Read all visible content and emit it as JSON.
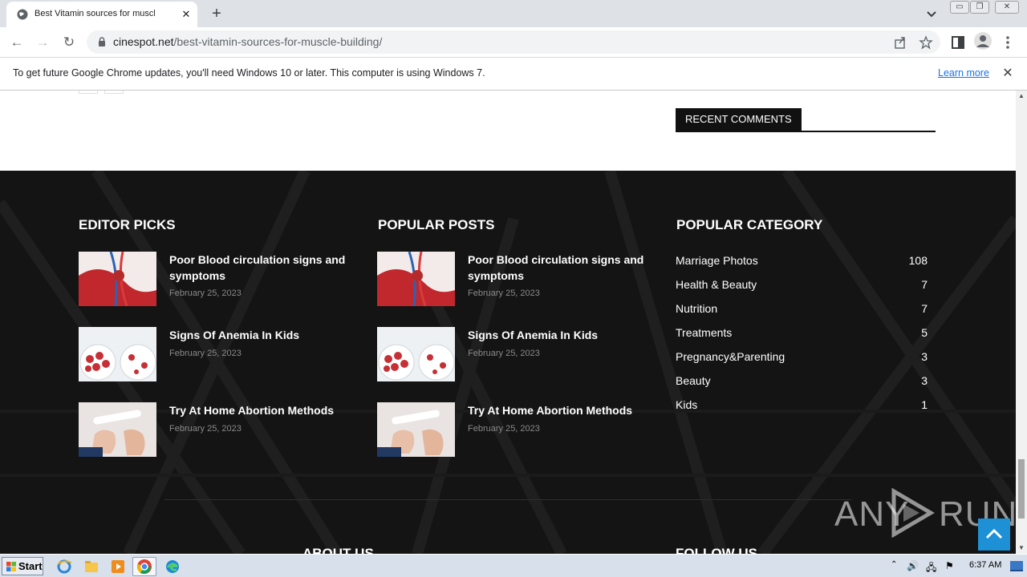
{
  "browser": {
    "tab_title": "Best Vitamin sources for muscle build",
    "url_domain": "cinespot.net",
    "url_path": "/best-vitamin-sources-for-muscle-building/",
    "infobar_message": "To get future Google Chrome updates, you'll need Windows 10 or later. This computer is using Windows 7.",
    "infobar_link": "Learn more"
  },
  "sidebar": {
    "recent_comments_heading": "RECENT COMMENTS"
  },
  "footer": {
    "editor_picks": {
      "title": "EDITOR PICKS",
      "posts": [
        {
          "title": "Poor Blood circulation signs and symptoms",
          "date": "February 25, 2023",
          "thumb": "blood-circulation"
        },
        {
          "title": "Signs Of Anemia In Kids",
          "date": "February 25, 2023",
          "thumb": "anemia"
        },
        {
          "title": "Try At Home Abortion Methods",
          "date": "February 25, 2023",
          "thumb": "pregnancy-test"
        }
      ]
    },
    "popular_posts": {
      "title": "POPULAR POSTS",
      "posts": [
        {
          "title": "Poor Blood circulation signs and symptoms",
          "date": "February 25, 2023",
          "thumb": "blood-circulation"
        },
        {
          "title": "Signs Of Anemia In Kids",
          "date": "February 25, 2023",
          "thumb": "anemia"
        },
        {
          "title": "Try At Home Abortion Methods",
          "date": "February 25, 2023",
          "thumb": "pregnancy-test"
        }
      ]
    },
    "popular_category": {
      "title": "POPULAR CATEGORY",
      "items": [
        {
          "name": "Marriage Photos",
          "count": "108"
        },
        {
          "name": "Health & Beauty",
          "count": "7"
        },
        {
          "name": "Nutrition",
          "count": "7"
        },
        {
          "name": "Treatments",
          "count": "5"
        },
        {
          "name": "Pregnancy&Parenting",
          "count": "3"
        },
        {
          "name": "Beauty",
          "count": "3"
        },
        {
          "name": "Kids",
          "count": "1"
        }
      ]
    },
    "about_title": "ABOUT US",
    "follow_title": "FOLLOW US"
  },
  "watermark": {
    "text": "ANY",
    "text2": "RUN"
  },
  "taskbar": {
    "start_label": "Start",
    "clock": "6:37 AM"
  },
  "colors": {
    "footer_bg": "#141414",
    "accent": "#1e90d6",
    "link": "#1a73e8"
  }
}
